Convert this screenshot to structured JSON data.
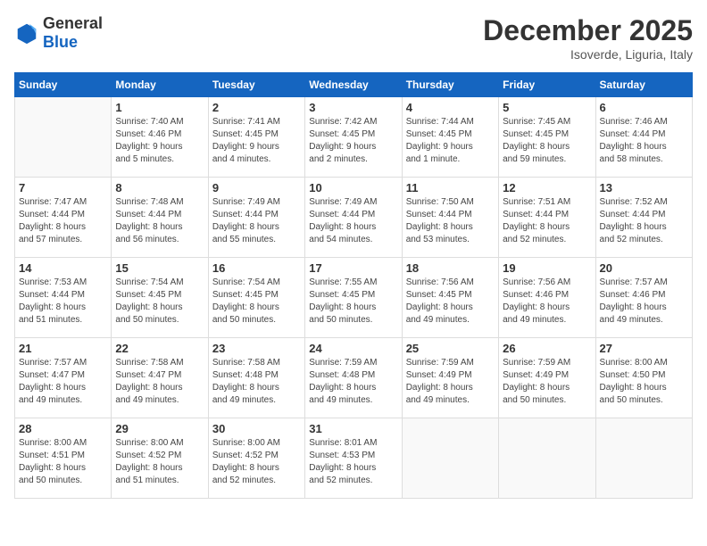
{
  "logo": {
    "general": "General",
    "blue": "Blue"
  },
  "title": {
    "month": "December 2025",
    "location": "Isoverde, Liguria, Italy"
  },
  "headers": [
    "Sunday",
    "Monday",
    "Tuesday",
    "Wednesday",
    "Thursday",
    "Friday",
    "Saturday"
  ],
  "weeks": [
    [
      {
        "day": "",
        "info": ""
      },
      {
        "day": "1",
        "info": "Sunrise: 7:40 AM\nSunset: 4:46 PM\nDaylight: 9 hours\nand 5 minutes."
      },
      {
        "day": "2",
        "info": "Sunrise: 7:41 AM\nSunset: 4:45 PM\nDaylight: 9 hours\nand 4 minutes."
      },
      {
        "day": "3",
        "info": "Sunrise: 7:42 AM\nSunset: 4:45 PM\nDaylight: 9 hours\nand 2 minutes."
      },
      {
        "day": "4",
        "info": "Sunrise: 7:44 AM\nSunset: 4:45 PM\nDaylight: 9 hours\nand 1 minute."
      },
      {
        "day": "5",
        "info": "Sunrise: 7:45 AM\nSunset: 4:45 PM\nDaylight: 8 hours\nand 59 minutes."
      },
      {
        "day": "6",
        "info": "Sunrise: 7:46 AM\nSunset: 4:44 PM\nDaylight: 8 hours\nand 58 minutes."
      }
    ],
    [
      {
        "day": "7",
        "info": "Sunrise: 7:47 AM\nSunset: 4:44 PM\nDaylight: 8 hours\nand 57 minutes."
      },
      {
        "day": "8",
        "info": "Sunrise: 7:48 AM\nSunset: 4:44 PM\nDaylight: 8 hours\nand 56 minutes."
      },
      {
        "day": "9",
        "info": "Sunrise: 7:49 AM\nSunset: 4:44 PM\nDaylight: 8 hours\nand 55 minutes."
      },
      {
        "day": "10",
        "info": "Sunrise: 7:49 AM\nSunset: 4:44 PM\nDaylight: 8 hours\nand 54 minutes."
      },
      {
        "day": "11",
        "info": "Sunrise: 7:50 AM\nSunset: 4:44 PM\nDaylight: 8 hours\nand 53 minutes."
      },
      {
        "day": "12",
        "info": "Sunrise: 7:51 AM\nSunset: 4:44 PM\nDaylight: 8 hours\nand 52 minutes."
      },
      {
        "day": "13",
        "info": "Sunrise: 7:52 AM\nSunset: 4:44 PM\nDaylight: 8 hours\nand 52 minutes."
      }
    ],
    [
      {
        "day": "14",
        "info": "Sunrise: 7:53 AM\nSunset: 4:44 PM\nDaylight: 8 hours\nand 51 minutes."
      },
      {
        "day": "15",
        "info": "Sunrise: 7:54 AM\nSunset: 4:45 PM\nDaylight: 8 hours\nand 50 minutes."
      },
      {
        "day": "16",
        "info": "Sunrise: 7:54 AM\nSunset: 4:45 PM\nDaylight: 8 hours\nand 50 minutes."
      },
      {
        "day": "17",
        "info": "Sunrise: 7:55 AM\nSunset: 4:45 PM\nDaylight: 8 hours\nand 50 minutes."
      },
      {
        "day": "18",
        "info": "Sunrise: 7:56 AM\nSunset: 4:45 PM\nDaylight: 8 hours\nand 49 minutes."
      },
      {
        "day": "19",
        "info": "Sunrise: 7:56 AM\nSunset: 4:46 PM\nDaylight: 8 hours\nand 49 minutes."
      },
      {
        "day": "20",
        "info": "Sunrise: 7:57 AM\nSunset: 4:46 PM\nDaylight: 8 hours\nand 49 minutes."
      }
    ],
    [
      {
        "day": "21",
        "info": "Sunrise: 7:57 AM\nSunset: 4:47 PM\nDaylight: 8 hours\nand 49 minutes."
      },
      {
        "day": "22",
        "info": "Sunrise: 7:58 AM\nSunset: 4:47 PM\nDaylight: 8 hours\nand 49 minutes."
      },
      {
        "day": "23",
        "info": "Sunrise: 7:58 AM\nSunset: 4:48 PM\nDaylight: 8 hours\nand 49 minutes."
      },
      {
        "day": "24",
        "info": "Sunrise: 7:59 AM\nSunset: 4:48 PM\nDaylight: 8 hours\nand 49 minutes."
      },
      {
        "day": "25",
        "info": "Sunrise: 7:59 AM\nSunset: 4:49 PM\nDaylight: 8 hours\nand 49 minutes."
      },
      {
        "day": "26",
        "info": "Sunrise: 7:59 AM\nSunset: 4:49 PM\nDaylight: 8 hours\nand 50 minutes."
      },
      {
        "day": "27",
        "info": "Sunrise: 8:00 AM\nSunset: 4:50 PM\nDaylight: 8 hours\nand 50 minutes."
      }
    ],
    [
      {
        "day": "28",
        "info": "Sunrise: 8:00 AM\nSunset: 4:51 PM\nDaylight: 8 hours\nand 50 minutes."
      },
      {
        "day": "29",
        "info": "Sunrise: 8:00 AM\nSunset: 4:52 PM\nDaylight: 8 hours\nand 51 minutes."
      },
      {
        "day": "30",
        "info": "Sunrise: 8:00 AM\nSunset: 4:52 PM\nDaylight: 8 hours\nand 52 minutes."
      },
      {
        "day": "31",
        "info": "Sunrise: 8:01 AM\nSunset: 4:53 PM\nDaylight: 8 hours\nand 52 minutes."
      },
      {
        "day": "",
        "info": ""
      },
      {
        "day": "",
        "info": ""
      },
      {
        "day": "",
        "info": ""
      }
    ]
  ]
}
